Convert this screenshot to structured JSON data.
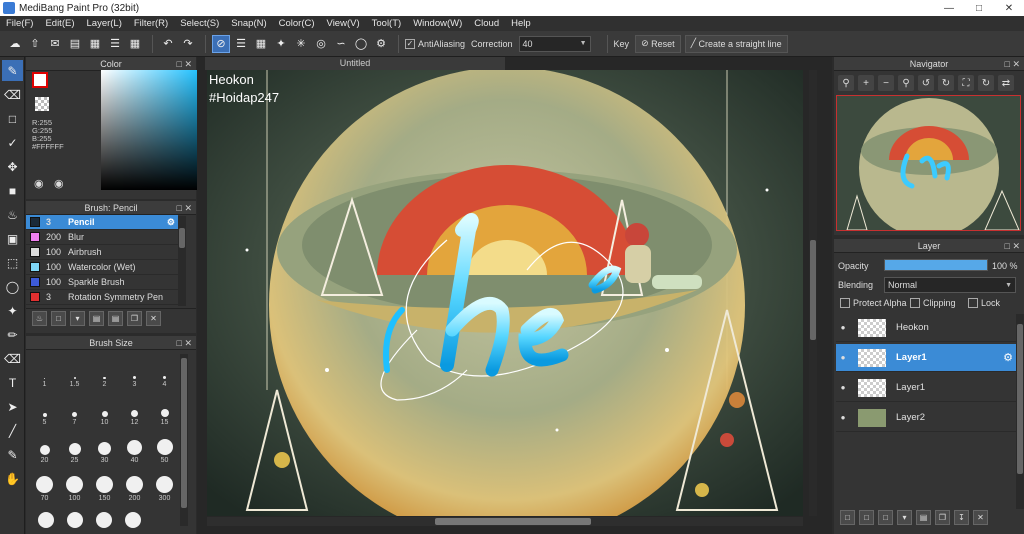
{
  "window": {
    "title": "MediBang Paint Pro (32bit)"
  },
  "menu": [
    "File(F)",
    "Edit(E)",
    "Layer(L)",
    "Filter(R)",
    "Select(S)",
    "Snap(N)",
    "Color(C)",
    "View(V)",
    "Tool(T)",
    "Window(W)",
    "Cloud",
    "Help"
  ],
  "toolbar": {
    "antialiasing_label": "AntiAliasing",
    "correction_label": "Correction",
    "correction_value": "40",
    "key_label": "Key",
    "reset_label": "Reset",
    "straight_line_label": "Create a straight line"
  },
  "color_panel": {
    "title": "Color",
    "r": "R:255",
    "g": "G:255",
    "b": "B:255",
    "hex": "#FFFFFF"
  },
  "brush_panel": {
    "title": "Brush: Pencil",
    "items": [
      {
        "size": "3",
        "name": "Pencil",
        "color": "#1a2a3a"
      },
      {
        "size": "200",
        "name": "Blur",
        "color": "#f080f0"
      },
      {
        "size": "100",
        "name": "Airbrush",
        "color": "#dddddd"
      },
      {
        "size": "100",
        "name": "Watercolor (Wet)",
        "color": "#7fd7f7"
      },
      {
        "size": "100",
        "name": "Sparkle Brush",
        "color": "#3d5bd9"
      },
      {
        "size": "3",
        "name": "Rotation Symmetry Pen",
        "color": "#e03030"
      }
    ]
  },
  "brush_size_panel": {
    "title": "Brush Size",
    "sizes": [
      "1",
      "1.5",
      "2",
      "3",
      "4",
      "5",
      "7",
      "10",
      "12",
      "15",
      "20",
      "25",
      "30",
      "40",
      "50",
      "70",
      "100",
      "150",
      "200",
      "300"
    ]
  },
  "canvas": {
    "tab_title": "Untitled",
    "text_line1": "Heokon",
    "text_line2": "#Hoidap247"
  },
  "navigator_panel": {
    "title": "Navigator"
  },
  "layer_panel": {
    "title": "Layer",
    "opacity_label": "Opacity",
    "opacity_value": "100 %",
    "opacity_fraction": 1.0,
    "blending_label": "Blending",
    "blending_value": "Normal",
    "protect_alpha_label": "Protect Alpha",
    "clipping_label": "Clipping",
    "lock_label": "Lock",
    "layers": [
      {
        "name": "Heokon"
      },
      {
        "name": "Layer1"
      },
      {
        "name": "Layer1"
      },
      {
        "name": "Layer2"
      }
    ]
  }
}
